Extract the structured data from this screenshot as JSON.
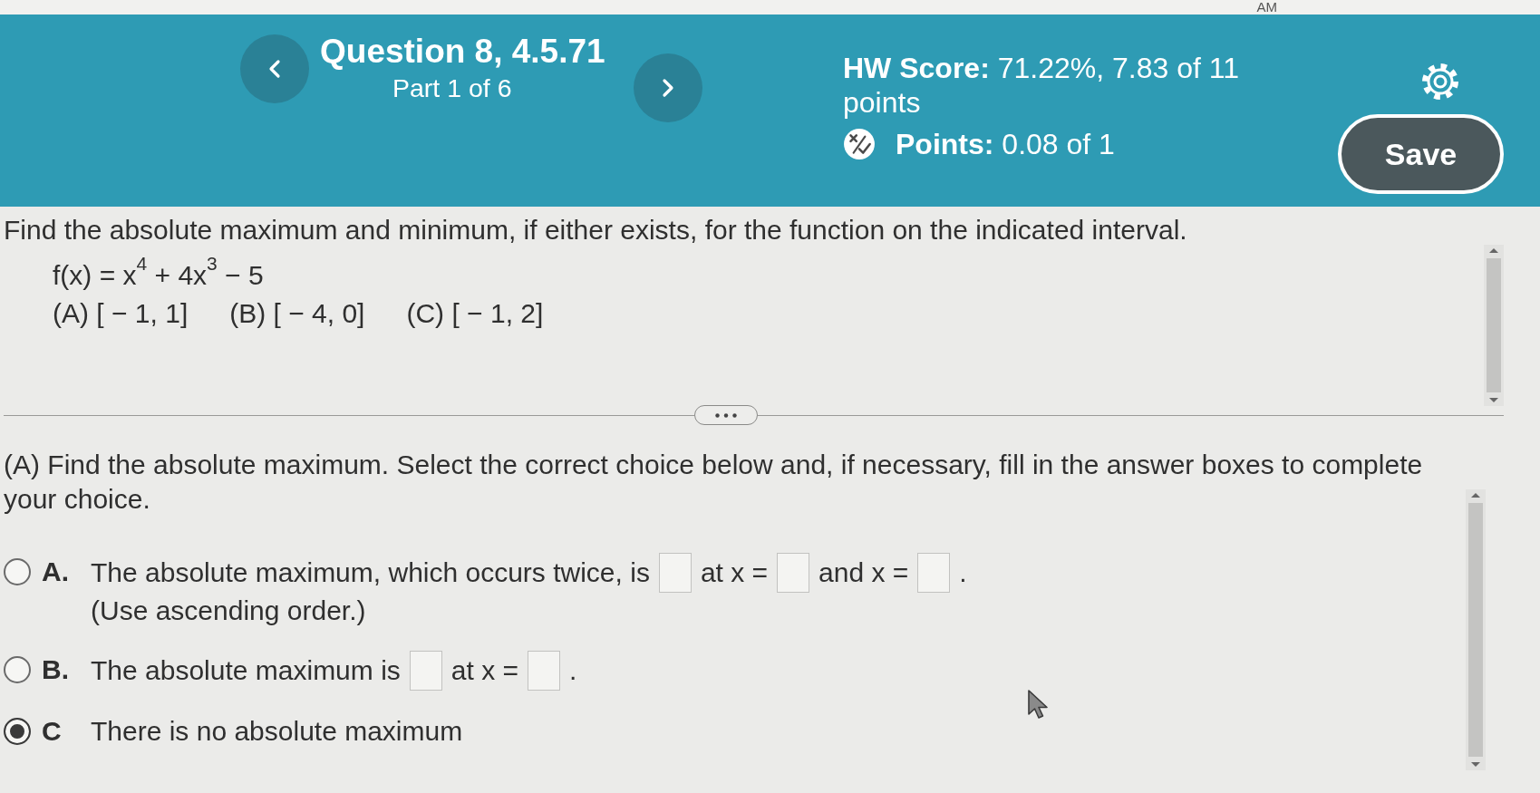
{
  "status_bar": {
    "time_fragment": "AM"
  },
  "header": {
    "title": "Question 8, 4.5.71",
    "part": "Part 1 of 6",
    "hw_score": "**HW Score:** 71.22%, 7.83 of 11 points",
    "points": "**Points:** 0.08 of 1",
    "save_button": "Save"
  },
  "question": {
    "prompt": "Find the absolute maximum and minimum, if either exists, for the function on the indicated interval.",
    "function": "f(x) = x$^{4}$ + 4x$^{3}$ − 5",
    "intervals": [
      "(A) [ − 1, 1]",
      "(B) [ − 4, 0]",
      "(C) [ − 1, 2]"
    ]
  },
  "part_a": {
    "instruction": "(A) Find the absolute maximum. Select the correct choice below and, if necessary, fill in the answer boxes to complete your choice.",
    "choices": [
      {
        "letter": "A.",
        "selected": false,
        "segments": [
          {
            "kind": "text",
            "text": "The absolute maximum, which occurs twice, is"
          },
          {
            "kind": "blank"
          },
          {
            "kind": "text",
            "text": "at x ="
          },
          {
            "kind": "blank"
          },
          {
            "kind": "text",
            "text": "and x ="
          },
          {
            "kind": "blank"
          },
          {
            "kind": "text",
            "text": "."
          }
        ],
        "note": "(Use ascending order.)"
      },
      {
        "letter": "B.",
        "selected": false,
        "segments": [
          {
            "kind": "text",
            "text": "The absolute maximum is"
          },
          {
            "kind": "blank"
          },
          {
            "kind": "text",
            "text": "at x ="
          },
          {
            "kind": "blank"
          },
          {
            "kind": "text",
            "text": "."
          }
        ]
      },
      {
        "letter": "C",
        "selected": true,
        "segments": [
          {
            "kind": "text",
            "text": "There is no absolute maximum"
          }
        ]
      }
    ]
  }
}
